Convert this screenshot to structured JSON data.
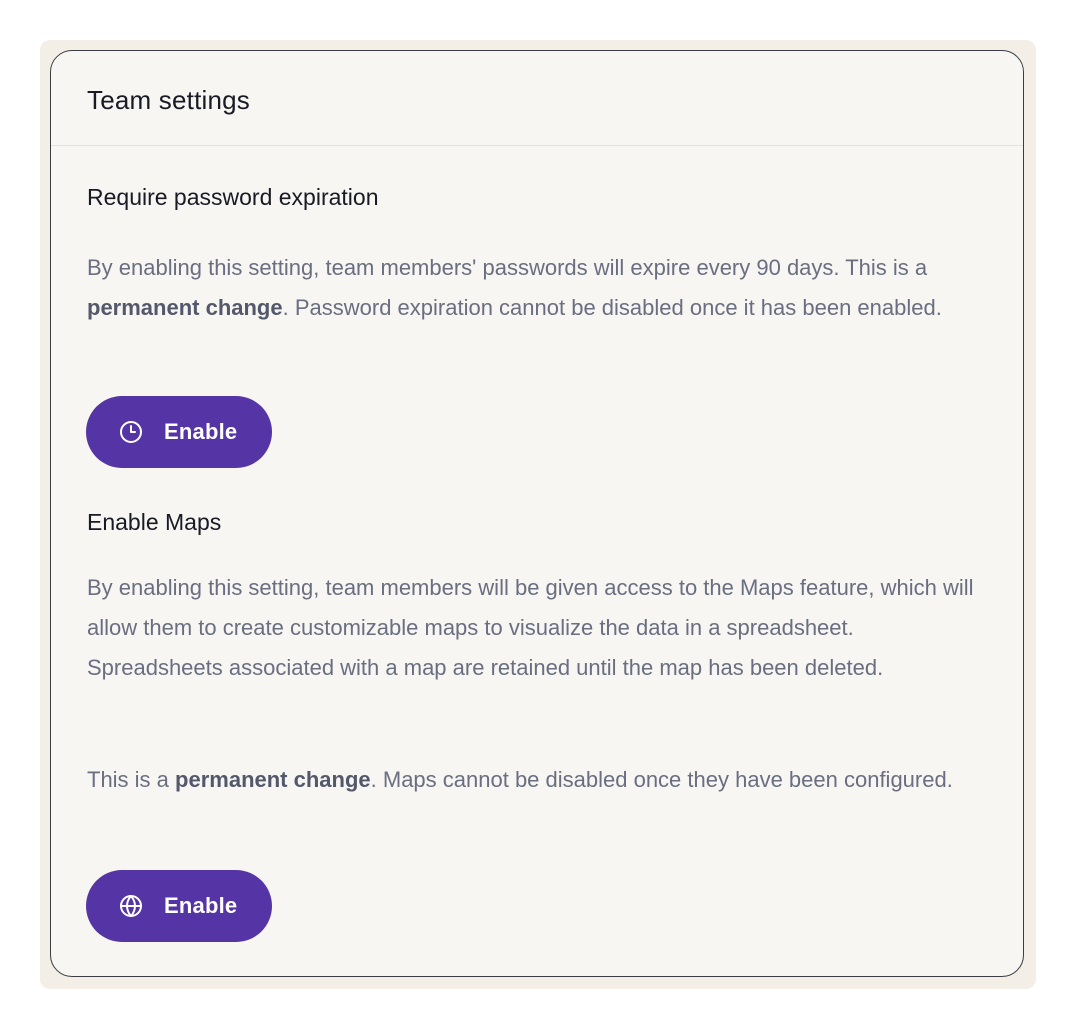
{
  "card": {
    "title": "Team settings"
  },
  "password_expiration": {
    "title": "Require password expiration",
    "text_before": "By enabling this setting, team members' passwords will expire every 90 days. This is a ",
    "text_bold": "permanent change",
    "text_after": ". Password expiration cannot be disabled once it has been enabled.",
    "button_label": "Enable",
    "button_icon": "clock-icon"
  },
  "maps": {
    "title": "Enable Maps",
    "paragraph1": "By enabling this setting, team members will be given access to the Maps feature, which will allow them to create customizable maps to visualize the data in a spreadsheet. Spreadsheets associated with a map are retained until the map has been deleted.",
    "p2_before": "This is a ",
    "p2_bold": "permanent change",
    "p2_after": ". Maps cannot be disabled once they have been configured.",
    "button_label": "Enable",
    "button_icon": "globe-icon"
  },
  "colors": {
    "button_bg": "#5534a5",
    "title_text": "#181a24",
    "body_text": "#6a6e80",
    "card_bg": "#f7f6f3",
    "outer_bg": "#f3efe6"
  }
}
